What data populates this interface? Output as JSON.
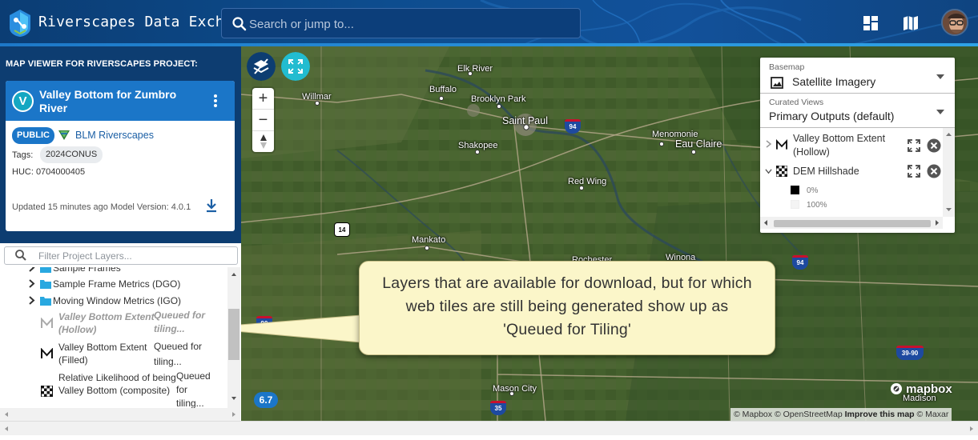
{
  "app": {
    "title": "Riverscapes Data Exchange"
  },
  "search": {
    "placeholder": "Search or jump to..."
  },
  "header_icons": [
    "dashboard-icon",
    "map-icon",
    "user-avatar"
  ],
  "sidebar": {
    "heading": "MAP VIEWER FOR RIVERSCAPES PROJECT:",
    "project": {
      "avatar_letter": "V",
      "title": "Valley Bottom for Zumbro River",
      "visibility": "PUBLIC",
      "organization": "BLM Riverscapes",
      "tags_label": "Tags:",
      "tags": [
        "2024CONUS"
      ],
      "huc": "HUC: 0704000405",
      "updated": "Updated 15 minutes ago Model Version: 4.0.1"
    },
    "filter_placeholder": "Filter Project Layers...",
    "tree": {
      "folders": [
        "Sample Frames",
        "Sample Frame Metrics (DGO)",
        "Moving Window Metrics (IGO)"
      ],
      "layers": [
        {
          "name": "Valley Bottom Extent (Hollow)",
          "status": "Queued for tiling...",
          "queued": true
        },
        {
          "name": "Valley Bottom Extent (Filled)",
          "status": "Queued for tiling...",
          "queued": false
        },
        {
          "name": "Relative Likelihood of being Valley Bottom (composite)",
          "status": "Queued for tiling...",
          "queued": false
        }
      ]
    }
  },
  "map": {
    "zoom_level": "6.7",
    "cities": [
      "Elk River",
      "Buffalo",
      "Willmar",
      "Brooklyn Park",
      "Saint Paul",
      "Menomonie",
      "Eau Claire",
      "Shakopee",
      "Red Wing",
      "Mankato",
      "Rochester",
      "Winona",
      "Mason City",
      "Madison"
    ],
    "highways": [
      "94",
      "94",
      "14",
      "94",
      "90",
      "39-90",
      "35"
    ],
    "basemap": {
      "label": "Basemap",
      "value": "Satellite Imagery"
    },
    "curated_views": {
      "label": "Curated Views",
      "value": "Primary Outputs (default)"
    },
    "active_layers": [
      {
        "name": "Valley Bottom Extent (Hollow)"
      },
      {
        "name": "DEM Hillshade",
        "legend": [
          "0%",
          "100%"
        ]
      }
    ],
    "callout": "Layers that are available for download, but for which web tiles are still being generated show up as 'Queued for Tiling'",
    "mapbox_logo": "mapbox",
    "attribution": {
      "mapbox": "© Mapbox",
      "osm": "© OpenStreetMap",
      "improve": "Improve this map",
      "maxar": "© Maxar"
    }
  },
  "colors": {
    "header": "#0d3d71",
    "accent": "#1b76c8",
    "callout_bg": "#fbf6c9"
  }
}
